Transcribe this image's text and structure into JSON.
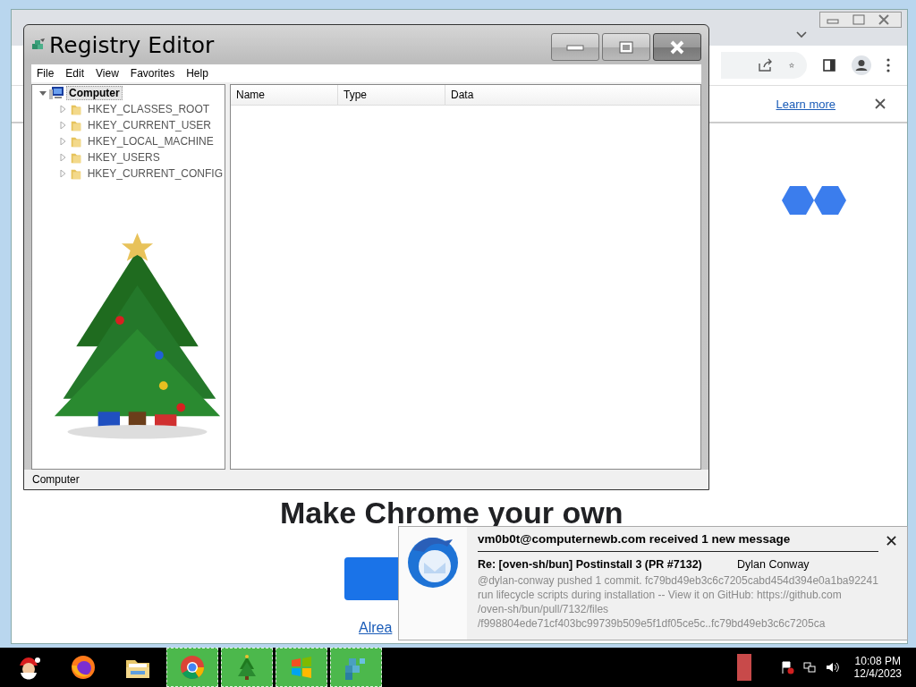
{
  "chrome_window": {
    "infobar_link": "Learn more",
    "heading": "Make Chrome your own",
    "signin_link": "Alrea"
  },
  "registry_editor": {
    "title": "Registry Editor",
    "menu": [
      "File",
      "Edit",
      "View",
      "Favorites",
      "Help"
    ],
    "tree": {
      "label": "Computer",
      "expanded": true,
      "selected": true,
      "children": [
        {
          "label": "HKEY_CLASSES_ROOT",
          "expanded": false
        },
        {
          "label": "HKEY_CURRENT_USER",
          "expanded": false
        },
        {
          "label": "HKEY_LOCAL_MACHINE",
          "expanded": false
        },
        {
          "label": "HKEY_USERS",
          "expanded": false
        },
        {
          "label": "HKEY_CURRENT_CONFIG",
          "expanded": false
        }
      ]
    },
    "columns": [
      "Name",
      "Type",
      "Data"
    ],
    "status_bar": "Computer"
  },
  "notification": {
    "title": "vm0b0t@computernewb.com received 1 new message",
    "subject": "Re: [oven-sh/bun] Postinstall 3 (PR #7132)",
    "sender": "Dylan Conway",
    "body_lines": [
      "@dylan-conway pushed 1 commit. fc79bd49eb3c6c7205cabd454d394e0a1ba92241",
      "run lifecycle scripts during installation -- View it on GitHub: https://github.com",
      "/oven-sh/bun/pull/7132/files",
      "/f998804ede71cf403bc99739b509e5f1df05ce5c..fc79bd49eb3c6c7205ca"
    ]
  },
  "taskbar": {
    "apps": [
      {
        "kind": "santa",
        "running": false
      },
      {
        "kind": "firefox",
        "running": false
      },
      {
        "kind": "folder",
        "running": false
      },
      {
        "kind": "chrome",
        "running": true
      },
      {
        "kind": "tree",
        "running": true
      },
      {
        "kind": "windows",
        "running": true
      },
      {
        "kind": "registry",
        "running": true
      }
    ],
    "clock": {
      "time": "10:08 PM",
      "date": "12/4/2023"
    }
  }
}
